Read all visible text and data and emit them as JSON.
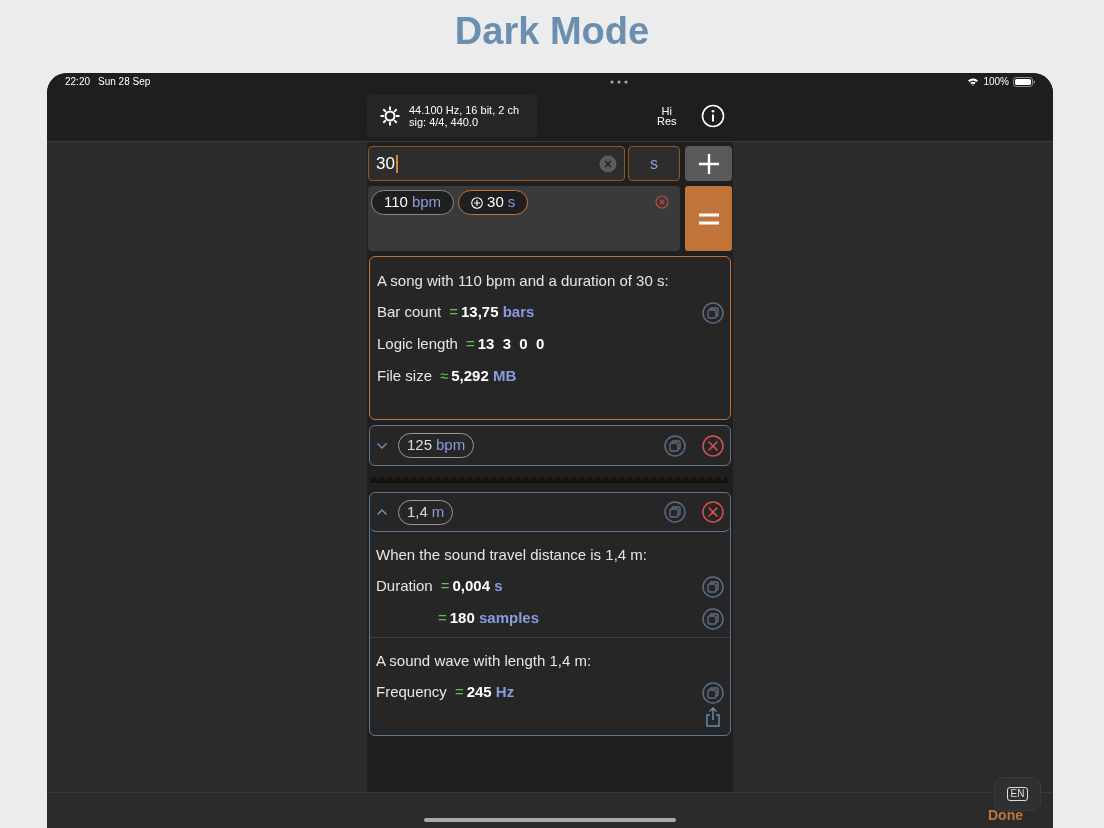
{
  "page_title": "Dark Mode",
  "status_bar": {
    "time": "22:20",
    "date": "Sun 28 Sep",
    "battery": "100%"
  },
  "toolbar": {
    "format_line1": "44.100 Hz, 16 bit, 2 ch",
    "format_line2": "sig: 4/4, 440.0",
    "hires_line1": "Hi",
    "hires_line2": "Res"
  },
  "input": {
    "value": "30",
    "unit": "s"
  },
  "chips": [
    {
      "value": "110",
      "unit": "bpm",
      "kind": "plain"
    },
    {
      "value": "30",
      "unit": "s",
      "kind": "added"
    }
  ],
  "result": {
    "heading": "A song with 110 bpm and a duration of 30 s:",
    "rows": [
      {
        "label": "Bar count",
        "op": "=",
        "value": "13,75",
        "unit": "bars",
        "copy": true
      },
      {
        "label": "Logic length",
        "op": "=",
        "value": "13  3  0  0",
        "copy": false
      },
      {
        "label": "File size",
        "op": "≈",
        "value": "5,292",
        "unit": "MB",
        "copy": false
      }
    ]
  },
  "cards": [
    {
      "expanded": false,
      "chip": {
        "value": "125",
        "unit": "bpm"
      }
    },
    {
      "expanded": true,
      "chip": {
        "value": "1,4",
        "unit": "m"
      },
      "sections": [
        {
          "heading": "When the sound travel distance is 1,4 m:",
          "rows": [
            {
              "label": "Duration",
              "op": "=",
              "value": "0,004",
              "unit": "s",
              "copy": true
            },
            {
              "op": "=",
              "value": "180",
              "unit": "samples",
              "copy": true
            }
          ]
        },
        {
          "heading": "A sound wave with length 1,4 m:",
          "rows": [
            {
              "label": "Frequency",
              "op": "=",
              "value": "245",
              "unit": "Hz",
              "copy": true
            }
          ],
          "share": true
        }
      ]
    }
  ],
  "keyboard_key": "EN",
  "done_label": "Done"
}
